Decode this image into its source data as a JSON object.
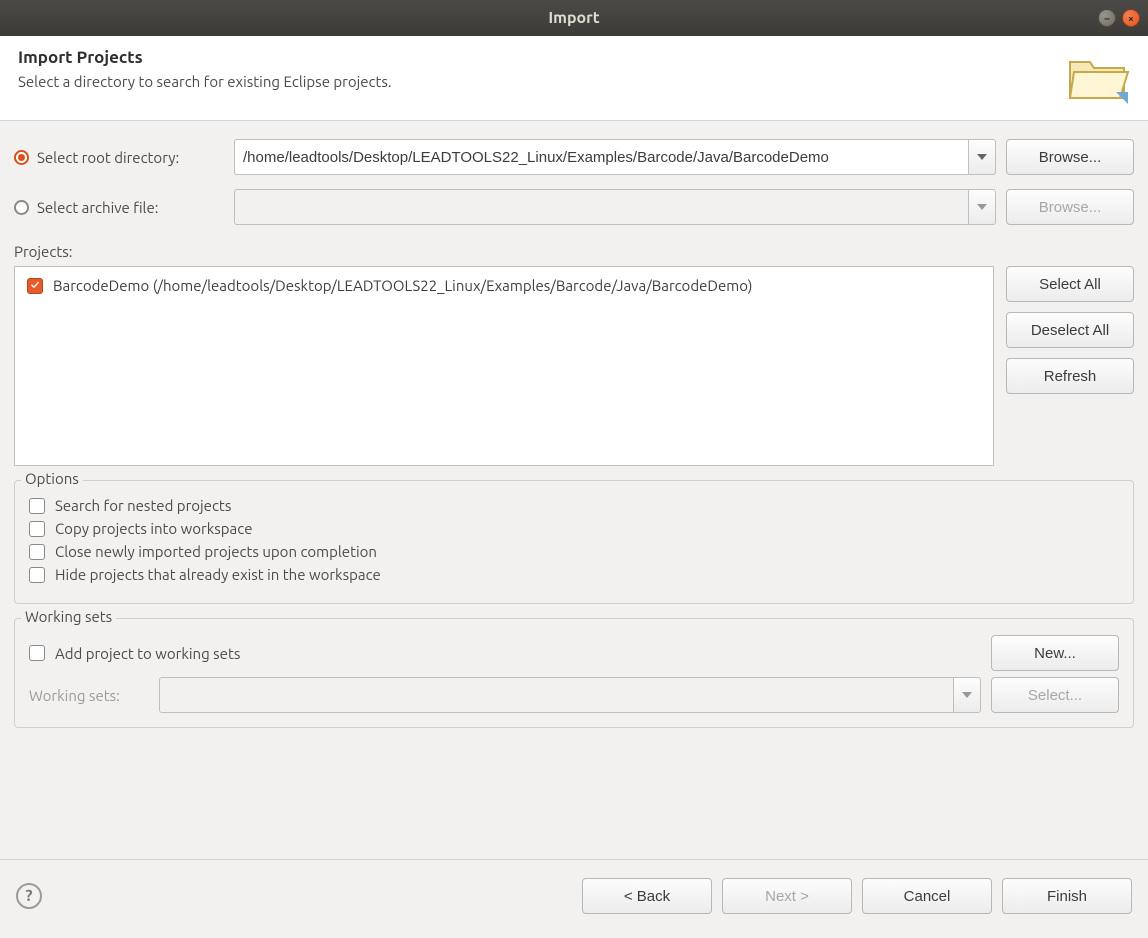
{
  "window": {
    "title": "Import"
  },
  "header": {
    "title": "Import Projects",
    "subtitle": "Select a directory to search for existing Eclipse projects."
  },
  "source": {
    "root_label": "Select root directory:",
    "root_value": "/home/leadtools/Desktop/LEADTOOLS22_Linux/Examples/Barcode/Java/BarcodeDemo",
    "archive_label": "Select archive file:",
    "archive_value": "",
    "browse_label": "Browse..."
  },
  "projects": {
    "label": "Projects:",
    "items": [
      {
        "checked": true,
        "label": "BarcodeDemo (/home/leadtools/Desktop/LEADTOOLS22_Linux/Examples/Barcode/Java/BarcodeDemo)"
      }
    ],
    "select_all": "Select All",
    "deselect_all": "Deselect All",
    "refresh": "Refresh"
  },
  "options": {
    "legend": "Options",
    "search_nested": "Search for nested projects",
    "copy_workspace": "Copy projects into workspace",
    "close_imported": "Close newly imported projects upon completion",
    "hide_existing": "Hide projects that already exist in the workspace"
  },
  "working_sets": {
    "legend": "Working sets",
    "add_label": "Add project to working sets",
    "new_label": "New...",
    "ws_label": "Working sets:",
    "select_label": "Select..."
  },
  "footer": {
    "back": "< Back",
    "next": "Next >",
    "cancel": "Cancel",
    "finish": "Finish"
  }
}
